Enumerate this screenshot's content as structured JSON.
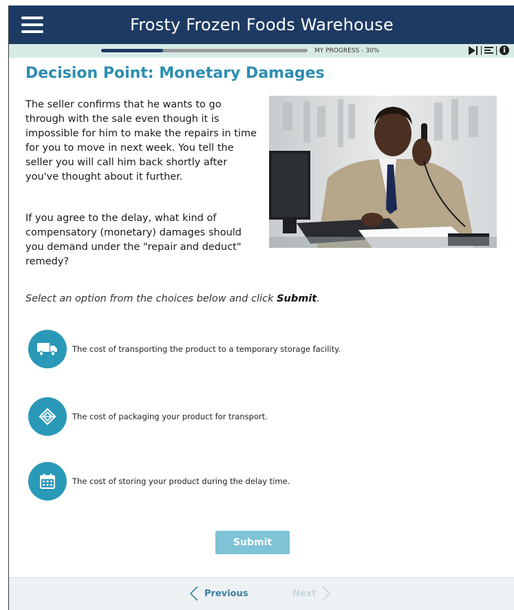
{
  "header": {
    "title": "Frosty Frozen Foods Warehouse",
    "menu_icon": "hamburger-menu-icon"
  },
  "progress": {
    "label": "MY PROGRESS - 30%",
    "percent": 30
  },
  "toolbar": {
    "icons": [
      "play-icon",
      "transcript-icon",
      "info-icon"
    ],
    "info_glyph": "i"
  },
  "page": {
    "title": "Decision Point: Monetary Damages",
    "paragraph1": "The seller confirms that he wants to go through with the sale even though it is impossible for him to make the repairs in time for you to move in next week. You tell the seller you will call him back shortly after you've thought about it further.",
    "paragraph2": "If you agree to the delay, what kind of compensatory (monetary) damages should you demand under the \"repair and deduct\" remedy?",
    "instruction_prefix": "Select an option from the choices below and click ",
    "instruction_bold": "Submit",
    "instruction_suffix": "."
  },
  "options": [
    {
      "text": "The cost of transporting the product to a temporary storage facility.",
      "icon": "truck-icon"
    },
    {
      "text": "The cost of packaging your product for transport.",
      "icon": "package-icon"
    },
    {
      "text": "The cost of storing your product during the delay time.",
      "icon": "calendar-icon"
    }
  ],
  "submit_label": "Submit",
  "nav": {
    "previous_label": "Previous",
    "next_label": "Next"
  },
  "colors": {
    "header_bg": "#1d3a63",
    "accent": "#2c8db0",
    "option_circle": "#2a99b8",
    "submit_bg": "#7ec3d6",
    "progress_row_bg": "#d7eae6"
  }
}
